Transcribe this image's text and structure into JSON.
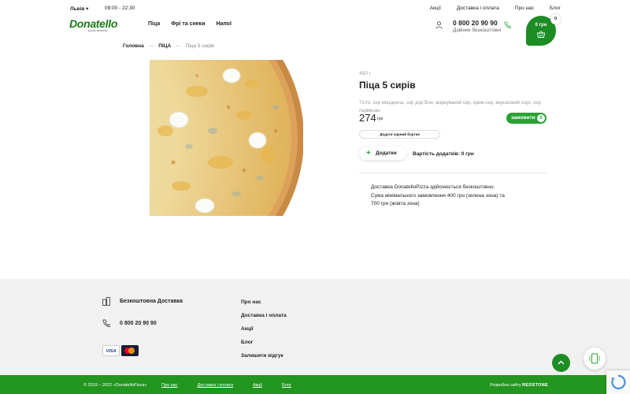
{
  "topbar": {
    "city": "Львів",
    "hours": "09:00 - 22:30",
    "links": [
      "Акції",
      "Доставка і оплата",
      "Про нас",
      "Блог"
    ]
  },
  "header": {
    "logo_name": "Donatello",
    "logo_sub": "pizza delivery",
    "nav": [
      "Піца",
      "Фрі та снеки",
      "Напої"
    ],
    "phone": "0 800 20 90 90",
    "phone_note": "Дзвінки безкоштовні",
    "cart_amount": "0 грн",
    "cart_count": "0"
  },
  "breadcrumb": {
    "home": "Головна",
    "category": "ПІЦА",
    "current": "Піца 5 сирів"
  },
  "product": {
    "weight": "450 г",
    "title": "Піца 5 сирів",
    "ingredients": "Тісто, сир моцарела, сир дор блю, маркуваний сир, крем-сир, вершковий соус, сир пармезан",
    "price": "274",
    "currency": "грн",
    "order_label": "замовити",
    "order_qty": "0",
    "crust_label": "Додати сирний бортик",
    "addons_label": "Додатки",
    "addons_cost": "Вартість додатків: 0 грн",
    "delivery_lines": [
      "Доставка DonatelloPizza здійснюється безкоштовно.",
      "Сума мінімального замовлення 400 грн (зелена зона) та",
      "700 грн (жовта зона)"
    ]
  },
  "footer": {
    "free_delivery": "Безкоштовна Доставка",
    "phone": "0 800 20 90 90",
    "cards": [
      "VISA"
    ],
    "links": [
      "Про нас",
      "Доставка і оплата",
      "Акції",
      "Блог",
      "Залишити відгук"
    ]
  },
  "bottombar": {
    "copyright": "© 2019 – 2022 «DonatelloPizza»",
    "links": [
      "Про нас",
      "Доставка і оплата",
      "Акції",
      "Блог"
    ],
    "developer_prefix": "Розробка сайту",
    "developer": "REDSTONE"
  },
  "colors": {
    "brand_green": "#1e8c24",
    "button_green": "#2aa233"
  }
}
